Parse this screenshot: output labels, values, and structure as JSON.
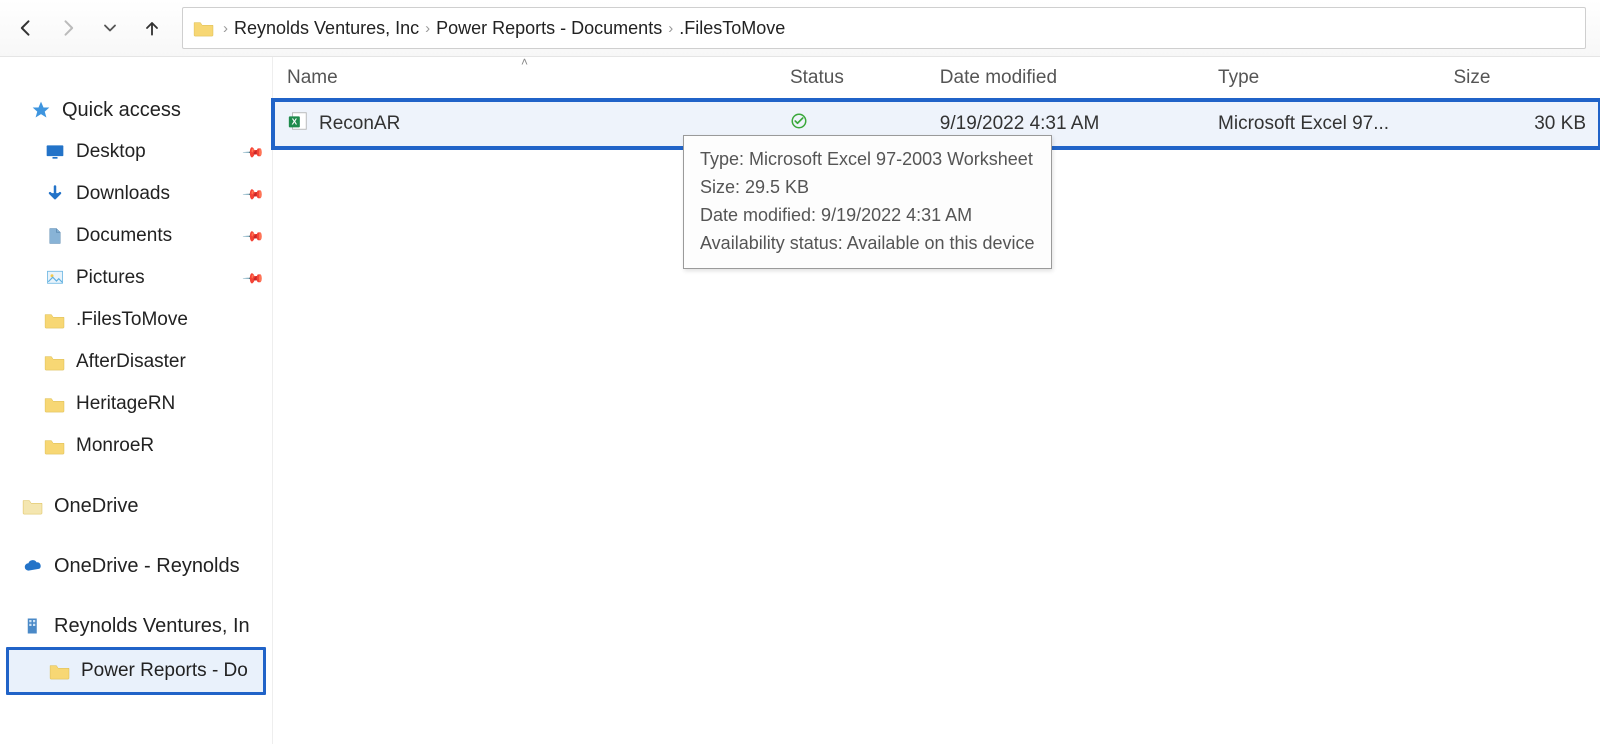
{
  "breadcrumb": {
    "seg0": "Reynolds Ventures, Inc",
    "seg1": "Power Reports - Documents",
    "seg2": ".FilesToMove"
  },
  "columns": {
    "name": "Name",
    "status": "Status",
    "date": "Date modified",
    "type": "Type",
    "size": "Size"
  },
  "files": [
    {
      "name": "ReconAR",
      "date": "9/19/2022 4:31 AM",
      "type": "Microsoft Excel 97...",
      "size": "30 KB"
    }
  ],
  "tooltip": {
    "line0": "Type: Microsoft Excel 97-2003 Worksheet",
    "line1": "Size: 29.5 KB",
    "line2": "Date modified: 9/19/2022 4:31 AM",
    "line3": "Availability status: Available on this device"
  },
  "sidebar": {
    "quick_access": "Quick access",
    "desktop": "Desktop",
    "downloads": "Downloads",
    "documents": "Documents",
    "pictures": "Pictures",
    "files_to_move": ".FilesToMove",
    "after_disaster": "AfterDisaster",
    "heritage_rn": "HeritageRN",
    "monroe_r": "MonroeR",
    "onedrive": "OneDrive",
    "onedrive_reynolds": "OneDrive - Reynolds",
    "reynolds_site": "Reynolds Ventures, In",
    "power_reports": "Power Reports - Do"
  }
}
